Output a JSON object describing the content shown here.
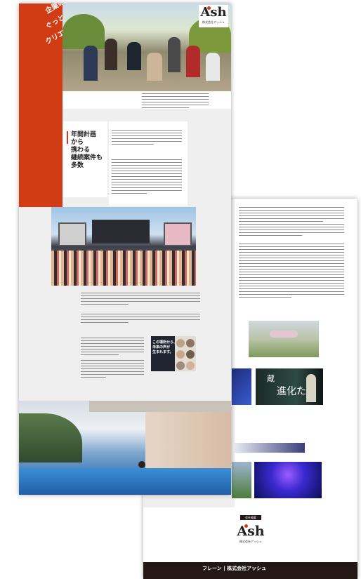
{
  "colors": {
    "accent": "#d23c14",
    "dark_footer": "#231815",
    "page_gray": "#efefef"
  },
  "hero": {
    "headline_1": "企業の課題に",
    "headline_2": "ぐっと、寄り添う",
    "headline_3": "クリエイティブチーム",
    "logo_text": "Ash",
    "logo_sub": "株式会社アッシュ"
  },
  "section": {
    "heading_1": "年間計画",
    "heading_2": "から",
    "heading_3": "携わる",
    "heading_4": "継続案件も",
    "heading_5": "多数"
  },
  "callout": {
    "line_1": "この場所から、",
    "line_2": "未来の声が",
    "line_3": "生まれます。"
  },
  "banner": {
    "line_1": "蔵",
    "line_2": "進化た"
  },
  "footer": {
    "logo_text": "Ash",
    "company": "株式会社アッシュ",
    "tag": "会社概要",
    "brand_line": "フレーン | 株式会社アッシュ"
  }
}
